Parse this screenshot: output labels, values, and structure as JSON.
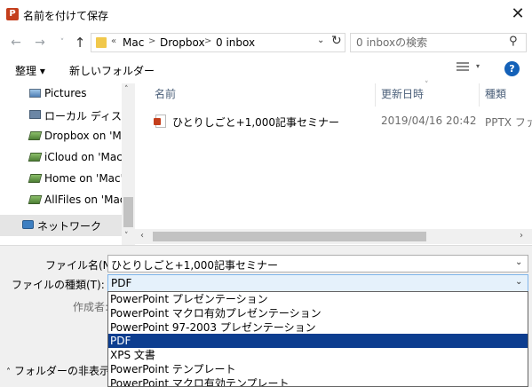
{
  "window": {
    "title": "名前を付けて保存",
    "app_icon_letter": "P"
  },
  "address": {
    "overflow": "«",
    "crumbs": [
      "Mac",
      "Dropbox",
      "0 inbox"
    ],
    "separator": ">"
  },
  "search": {
    "placeholder": "0 inboxの検索"
  },
  "toolbar": {
    "organize_label": "整理 ▾",
    "new_folder_label": "新しいフォルダー"
  },
  "nav": {
    "items": [
      {
        "label": "Pictures",
        "icon": "pictures-icon"
      },
      {
        "label": "ローカル ディスク (C",
        "icon": "disk-icon"
      },
      {
        "label": "Dropbox on 'Mac",
        "icon": "network-drive-icon"
      },
      {
        "label": "iCloud on 'Mac'",
        "icon": "network-drive-icon"
      },
      {
        "label": "Home on 'Mac' (",
        "icon": "network-drive-icon"
      },
      {
        "label": "AllFiles on 'Mac'",
        "icon": "network-drive-icon"
      },
      {
        "label": "ネットワーク",
        "icon": "network-icon"
      }
    ]
  },
  "filelist": {
    "columns": [
      "名前",
      "更新日時",
      "種類"
    ],
    "files": [
      {
        "name": "ひとりしごと+1,000記事セミナー",
        "modified": "2019/04/16 20:42",
        "type": "PPTX ファイ"
      }
    ]
  },
  "form": {
    "filename_label": "ファイル名(N):",
    "filename_value": "ひとりしごと+1,000記事セミナー",
    "filetype_label": "ファイルの種類(T):",
    "filetype_value": "PDF",
    "author_label": "作成者:",
    "hide_folders_label": "フォルダーの非表示"
  },
  "filetype_options": [
    "PowerPoint プレゼンテーション",
    "PowerPoint マクロ有効プレゼンテーション",
    "PowerPoint 97-2003 プレゼンテーション",
    "PDF",
    "XPS 文書",
    "PowerPoint テンプレート",
    "PowerPoint マクロ有効テンプレート"
  ],
  "selected_option": "PDF",
  "colors": {
    "selection": "#0c3d8f",
    "help": "#1461b8",
    "ppt": "#c43e1c"
  }
}
